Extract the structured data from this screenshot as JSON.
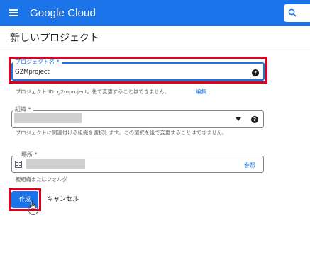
{
  "header": {
    "brand": "Google Cloud",
    "menu_icon": "hamburger-menu-icon",
    "search_icon": "search-icon",
    "color": "#1a73e8"
  },
  "page": {
    "title": "新しいプロジェクト"
  },
  "form": {
    "project_name": {
      "label": "プロジェクト名 *",
      "value": "G2Mproject",
      "help_icon": "?"
    },
    "project_id_hint": "プロジェクト ID: g2mproject。後で変更することはできません。",
    "edit_link": "編集",
    "organization": {
      "label": "組織 *",
      "help_icon": "?",
      "hint": "プロジェクトに関連付ける組織を選択します。この選択を後で変更することはできません。"
    },
    "location": {
      "label": "場所 *",
      "browse_link": "参照",
      "hint": "親組織またはフォルダ"
    }
  },
  "actions": {
    "create_label": "作成",
    "cancel_label": "キャンセル"
  },
  "colors": {
    "accent": "#1a73e8",
    "highlight": "#e00022"
  }
}
